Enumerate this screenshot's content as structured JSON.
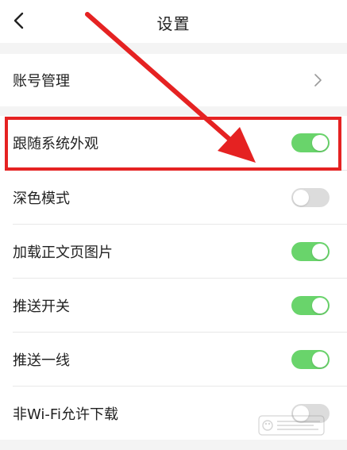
{
  "header": {
    "title": "设置"
  },
  "account": {
    "label": "账号管理"
  },
  "settings": [
    {
      "label": "跟随系统外观",
      "on": true
    },
    {
      "label": "深色模式",
      "on": false
    },
    {
      "label": "加载正文页图片",
      "on": true
    },
    {
      "label": "推送开关",
      "on": true
    },
    {
      "label": "推送一线",
      "on": true
    },
    {
      "label": "非Wi-Fi允许下载",
      "on": false
    }
  ],
  "colors": {
    "toggle_on": "#69d46b",
    "toggle_off": "#dcdcdc",
    "annotation": "#e52222"
  },
  "icons": {
    "back": "chevron-left-icon",
    "account_chevron": "chevron-right-icon",
    "watermark": "baidu-jingyan-watermark"
  }
}
